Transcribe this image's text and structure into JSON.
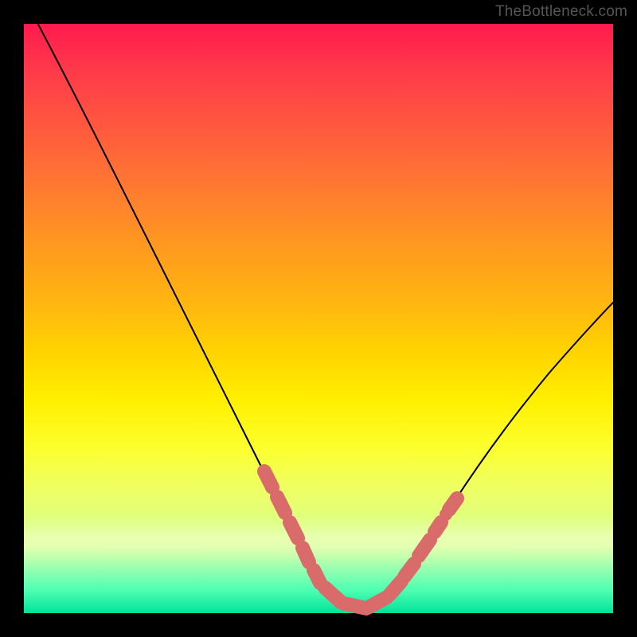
{
  "watermark": "TheBottleneck.com",
  "chart_data": {
    "type": "line",
    "title": "",
    "xlabel": "",
    "ylabel": "",
    "xlim": [
      0,
      100
    ],
    "ylim": [
      0,
      100
    ],
    "x": [
      0,
      6,
      12,
      18,
      24,
      30,
      34,
      38,
      42,
      45,
      48,
      50,
      52,
      54,
      56,
      58,
      60,
      62,
      66,
      72,
      80,
      90,
      100
    ],
    "y": [
      100,
      90,
      80,
      70,
      60,
      50,
      42,
      34,
      25,
      17,
      9,
      4,
      1,
      0,
      0,
      1,
      4,
      8,
      16,
      26,
      38,
      50,
      60
    ],
    "markers": {
      "comment": "Highlighted (coral) data points on and near the valley",
      "x": [
        40,
        42,
        44,
        46,
        48,
        50,
        52,
        54,
        56,
        58,
        60,
        62,
        64,
        66
      ],
      "y": [
        24,
        20,
        15,
        11,
        7,
        3,
        1,
        0,
        0,
        1,
        4,
        8,
        12,
        17
      ]
    },
    "background_gradient_top_color": "#ff1a4d",
    "background_gradient_bottom_color": "#00e39a",
    "curve_color": "#000000",
    "marker_color": "#d96b6b"
  }
}
